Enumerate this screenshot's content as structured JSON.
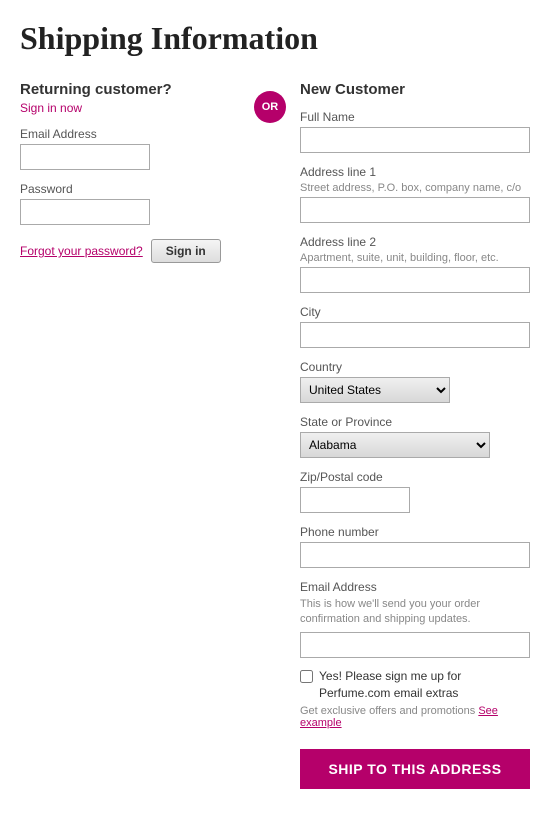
{
  "page": {
    "title": "Shipping Information"
  },
  "returning": {
    "title": "Returning customer?",
    "sign_in_link": "Sign in now",
    "email_label": "Email Address",
    "password_label": "Password",
    "forgot_label": "Forgot your password?",
    "sign_in_button": "Sign in",
    "or_label": "OR"
  },
  "new_customer": {
    "title": "New Customer",
    "full_name_label": "Full Name",
    "address1_label": "Address line 1",
    "address1_sublabel": "Street address, P.O. box, company name, c/o",
    "address2_label": "Address line 2",
    "address2_sublabel": "Apartment, suite, unit, building, floor, etc.",
    "city_label": "City",
    "country_label": "Country",
    "country_value": "United States",
    "state_label": "State or Province",
    "state_value": "Alabama",
    "zip_label": "Zip/Postal code",
    "phone_label": "Phone number",
    "email_label": "Email Address",
    "email_helper": "This is how we'll send you your order confirmation and shipping updates.",
    "checkbox_text": "Yes! Please sign me up for Perfume.com email extras",
    "promo_text": "Get exclusive offers and promotions",
    "see_example": "See example",
    "ship_button": "SHIP TO THIS ADDRESS"
  }
}
